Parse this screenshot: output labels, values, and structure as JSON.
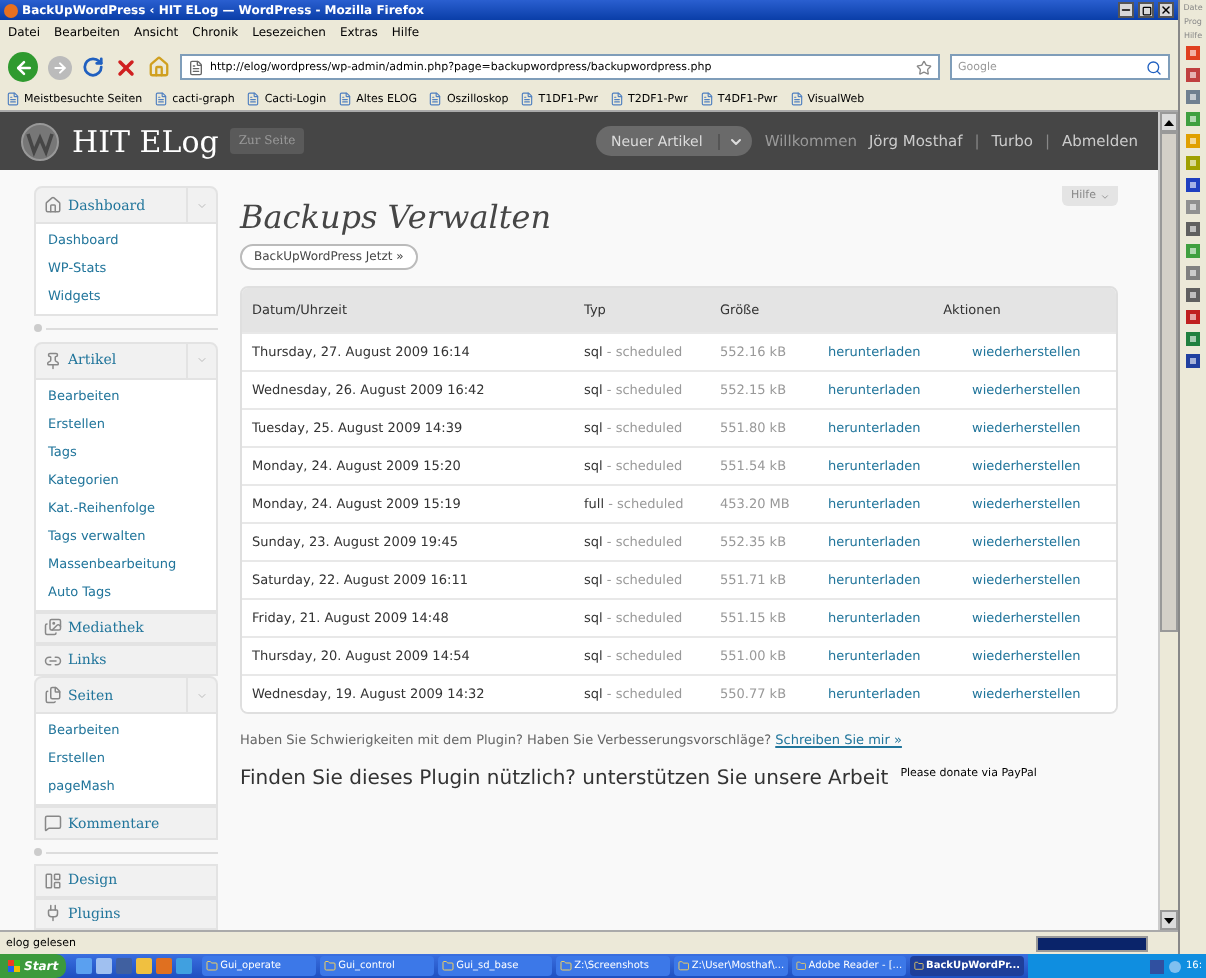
{
  "window": {
    "title": "BackUpWordPress ‹ HIT ELog — WordPress - Mozilla Firefox"
  },
  "menu": [
    "Datei",
    "Bearbeiten",
    "Ansicht",
    "Chronik",
    "Lesezeichen",
    "Extras",
    "Hilfe"
  ],
  "navbar": {
    "url": "http://elog/wordpress/wp-admin/admin.php?page=backupwordpress/backupwordpress.php",
    "search": {
      "placeholder": "Google"
    }
  },
  "bookmarks": [
    "Meistbesuchte Seiten",
    "cacti-graph",
    "Cacti-Login",
    "Altes ELOG",
    "Oszilloskop",
    "T1DF1-Pwr",
    "T2DF1-Pwr",
    "T4DF1-Pwr",
    "VisualWeb"
  ],
  "header": {
    "site": "HIT ELog",
    "visit": "Zur Seite",
    "new_post": "Neuer Artikel",
    "greeting": "Willkommen",
    "user_items": [
      {
        "kind": "link",
        "text": "Jörg Mosthaf"
      },
      {
        "kind": "separator",
        "text": "|"
      },
      {
        "kind": "link",
        "text": "Turbo"
      },
      {
        "kind": "separator",
        "text": "|"
      },
      {
        "kind": "link",
        "text": "Abmelden"
      }
    ]
  },
  "sidebar": [
    {
      "kind": "group",
      "label": "Dashboard",
      "expanded": true,
      "items": [
        "Dashboard",
        "WP-Stats",
        "Widgets"
      ]
    },
    {
      "kind": "separator"
    },
    {
      "kind": "group",
      "label": "Artikel",
      "expanded": true,
      "items": [
        "Bearbeiten",
        "Erstellen",
        "Tags",
        "Kategorien",
        "Kat.-Reihenfolge",
        "Tags verwalten",
        "Massenbearbeitung",
        "Auto Tags"
      ]
    },
    {
      "kind": "group",
      "label": "Mediathek",
      "expanded": false
    },
    {
      "kind": "group",
      "label": "Links",
      "expanded": false
    },
    {
      "kind": "group",
      "label": "Seiten",
      "expanded": true,
      "items": [
        "Bearbeiten",
        "Erstellen",
        "pageMash"
      ]
    },
    {
      "kind": "group",
      "label": "Kommentare",
      "expanded": false
    },
    {
      "kind": "separator"
    },
    {
      "kind": "group",
      "label": "Design",
      "expanded": false
    },
    {
      "kind": "group",
      "label": "Plugins",
      "expanded": false
    }
  ],
  "help": "Hilfe",
  "page": {
    "title": "Backups Verwalten",
    "backup_button": "BackUpWordPress Jetzt »"
  },
  "table": {
    "columns": [
      "Datum/Uhrzeit",
      "Typ",
      "Größe",
      "Aktionen"
    ],
    "rows": [
      {
        "date": "Thursday, 27. August 2009 16:14",
        "type": "sql",
        "note": "- scheduled",
        "size": "552.16 kB",
        "download": "herunterladen",
        "restore": "wiederherstellen"
      },
      {
        "date": "Wednesday, 26. August 2009 16:42",
        "type": "sql",
        "note": "- scheduled",
        "size": "552.15 kB",
        "download": "herunterladen",
        "restore": "wiederherstellen"
      },
      {
        "date": "Tuesday, 25. August 2009 14:39",
        "type": "sql",
        "note": "- scheduled",
        "size": "551.80 kB",
        "download": "herunterladen",
        "restore": "wiederherstellen"
      },
      {
        "date": "Monday, 24. August 2009 15:20",
        "type": "sql",
        "note": "- scheduled",
        "size": "551.54 kB",
        "download": "herunterladen",
        "restore": "wiederherstellen"
      },
      {
        "date": "Monday, 24. August 2009 15:19",
        "type": "full",
        "note": "- scheduled",
        "size": "453.20 MB",
        "download": "herunterladen",
        "restore": "wiederherstellen"
      },
      {
        "date": "Sunday, 23. August 2009 19:45",
        "type": "sql",
        "note": "- scheduled",
        "size": "552.35 kB",
        "download": "herunterladen",
        "restore": "wiederherstellen"
      },
      {
        "date": "Saturday, 22. August 2009 16:11",
        "type": "sql",
        "note": "- scheduled",
        "size": "551.71 kB",
        "download": "herunterladen",
        "restore": "wiederherstellen"
      },
      {
        "date": "Friday, 21. August 2009 14:48",
        "type": "sql",
        "note": "- scheduled",
        "size": "551.15 kB",
        "download": "herunterladen",
        "restore": "wiederherstellen"
      },
      {
        "date": "Thursday, 20. August 2009 14:54",
        "type": "sql",
        "note": "- scheduled",
        "size": "551.00 kB",
        "download": "herunterladen",
        "restore": "wiederherstellen"
      },
      {
        "date": "Wednesday, 19. August 2009 14:32",
        "type": "sql",
        "note": "- scheduled",
        "size": "550.77 kB",
        "download": "herunterladen",
        "restore": "wiederherstellen"
      }
    ]
  },
  "support": {
    "question": "Haben Sie Schwierigkeiten mit dem Plugin? Haben Sie Verbesserungsvorschläge?",
    "link": "Schreiben Sie mir »",
    "donate_text": "Finden Sie dieses Plugin nützlich? unterstützen Sie unsere Arbeit",
    "donate_link": "Please donate via PayPal"
  },
  "status_bar": {
    "text": "elog gelesen",
    "progress": {
      "level": 1
    }
  },
  "side_app": {
    "menu": [
      "Date",
      "Prog",
      "Hilfe"
    ]
  },
  "taskbar": {
    "start": "Start",
    "tasks": [
      {
        "label": "Gui_operate",
        "selected": false
      },
      {
        "label": "Gui_control",
        "selected": false
      },
      {
        "label": "Gui_sd_base",
        "selected": false
      },
      {
        "label": "Z:\\Screenshots",
        "selected": false
      },
      {
        "label": "Z:\\User\\Mosthaf\\...",
        "selected": false
      },
      {
        "label": "Adobe Reader - [...",
        "selected": false
      },
      {
        "label": "BackUpWordPr...",
        "selected": true
      }
    ],
    "clock": "16:"
  }
}
